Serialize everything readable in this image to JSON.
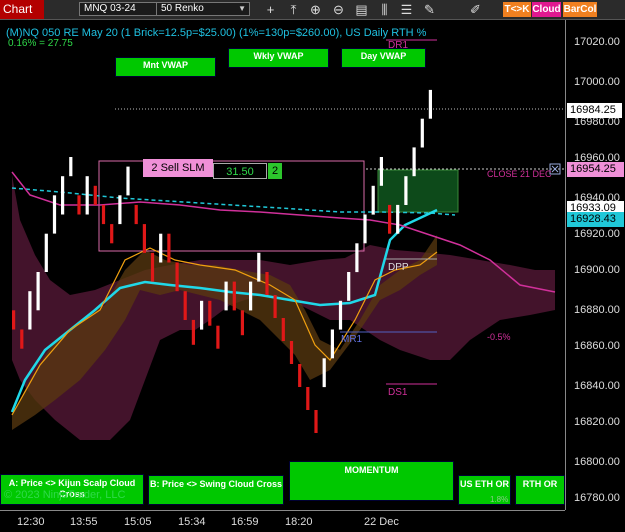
{
  "toolbar": {
    "chart_tab": "Chart",
    "instrument": "MNQ 03-24",
    "bar_type": "50 Renko",
    "icons": [
      "plus-icon",
      "nav-up-icon",
      "zoom-in-icon",
      "zoom-out-icon",
      "properties-icon",
      "bar-style-icon",
      "data-box-icon",
      "drawing-icon",
      "draw-tools-icon"
    ],
    "buttons": {
      "tk": "T<>K",
      "cloud": "Cloud",
      "barcol": "BarCol"
    },
    "colors": {
      "tk": "#f08020",
      "cloud": "#e01890",
      "barcol": "#f08020"
    }
  },
  "header": {
    "title": "(M)NQ 050 RE May 20 (1 Brick=12.5p=$25.00) (1%=130p=$260.00), US Daily RTH %",
    "subtitle": "0.16% = 27.75"
  },
  "vwap_buttons": {
    "monthly": "Mnt VWAP",
    "weekly": "Wkly VWAP",
    "daily": "Day VWAP"
  },
  "order": {
    "label": "2 Sell SLM",
    "price": "31.50",
    "qty": "2"
  },
  "levels": {
    "dr1": "DR1",
    "dpp": "DPP",
    "mr1": "MR1",
    "ds1": "DS1",
    "close_label": "CLOSE 21 DEC",
    "pct": "-0.5%"
  },
  "price_axis": {
    "ticks": [
      "17020.00",
      "17000.00",
      "16980.00",
      "16960.00",
      "16940.00",
      "16920.00",
      "16900.00",
      "16880.00",
      "16860.00",
      "16840.00",
      "16820.00",
      "16800.00",
      "16780.00"
    ],
    "last_price": "16984.25",
    "close_price": "16954.25",
    "price_c": "16933.09",
    "price_d": "16928.43"
  },
  "time_axis": [
    "12:30",
    "13:55",
    "15:05",
    "15:34",
    "16:59",
    "18:20",
    "22 Dec"
  ],
  "bottom_buttons": {
    "a": "A: Price <> Kijun Scalp Cloud Cross",
    "b": "B: Price <> Swing Cloud Cross",
    "momentum": "MOMENTUM",
    "us_eth": "US ETH OR",
    "rth": "RTH OR",
    "small_value": "1.8%"
  },
  "copyright": "© 2023 NinjaTrader, LLC",
  "chart_data": {
    "type": "renko",
    "instrument": "MNQ 03-24",
    "brick_size": 12.5,
    "ylim": [
      16780,
      17030
    ],
    "x": [
      "12:30",
      "13:55",
      "15:05",
      "15:34",
      "16:59",
      "18:20",
      "22 Dec"
    ],
    "bricks": [
      {
        "o": 16880,
        "c": 16870
      },
      {
        "o": 16870,
        "c": 16860
      },
      {
        "o": 16870,
        "c": 16890
      },
      {
        "o": 16880,
        "c": 16900
      },
      {
        "o": 16900,
        "c": 16920
      },
      {
        "o": 16920,
        "c": 16940
      },
      {
        "o": 16930,
        "c": 16950
      },
      {
        "o": 16950,
        "c": 16960
      },
      {
        "o": 16940,
        "c": 16930
      },
      {
        "o": 16930,
        "c": 16950
      },
      {
        "o": 16945,
        "c": 16935
      },
      {
        "o": 16935,
        "c": 16925
      },
      {
        "o": 16925,
        "c": 16915
      },
      {
        "o": 16925,
        "c": 16940
      },
      {
        "o": 16940,
        "c": 16955
      },
      {
        "o": 16935,
        "c": 16925
      },
      {
        "o": 16925,
        "c": 16910
      },
      {
        "o": 16910,
        "c": 16895
      },
      {
        "o": 16905,
        "c": 16920
      },
      {
        "o": 16920,
        "c": 16905
      },
      {
        "o": 16905,
        "c": 16890
      },
      {
        "o": 16890,
        "c": 16875
      },
      {
        "o": 16875,
        "c": 16862
      },
      {
        "o": 16870,
        "c": 16885
      },
      {
        "o": 16885,
        "c": 16872
      },
      {
        "o": 16872,
        "c": 16860
      },
      {
        "o": 16880,
        "c": 16895
      },
      {
        "o": 16895,
        "c": 16880
      },
      {
        "o": 16880,
        "c": 16867
      },
      {
        "o": 16880,
        "c": 16895
      },
      {
        "o": 16895,
        "c": 16910
      },
      {
        "o": 16900,
        "c": 16888
      },
      {
        "o": 16888,
        "c": 16876
      },
      {
        "o": 16876,
        "c": 16864
      },
      {
        "o": 16864,
        "c": 16852
      },
      {
        "o": 16852,
        "c": 16840
      },
      {
        "o": 16840,
        "c": 16828
      },
      {
        "o": 16828,
        "c": 16816
      },
      {
        "o": 16840,
        "c": 16855
      },
      {
        "o": 16855,
        "c": 16870
      },
      {
        "o": 16870,
        "c": 16885
      },
      {
        "o": 16885,
        "c": 16900
      },
      {
        "o": 16900,
        "c": 16915
      },
      {
        "o": 16915,
        "c": 16930
      },
      {
        "o": 16930,
        "c": 16945
      },
      {
        "o": 16945,
        "c": 16960
      },
      {
        "o": 16935,
        "c": 16920
      },
      {
        "o": 16920,
        "c": 16935
      },
      {
        "o": 16935,
        "c": 16950
      },
      {
        "o": 16950,
        "c": 16965
      },
      {
        "o": 16965,
        "c": 16980
      },
      {
        "o": 16980,
        "c": 16995
      }
    ],
    "levels": {
      "DR1": 17017,
      "DPP": 16905,
      "MR1": 16869,
      "DS1": 16842,
      "CLOSE 21 DEC": 16954.25
    }
  }
}
